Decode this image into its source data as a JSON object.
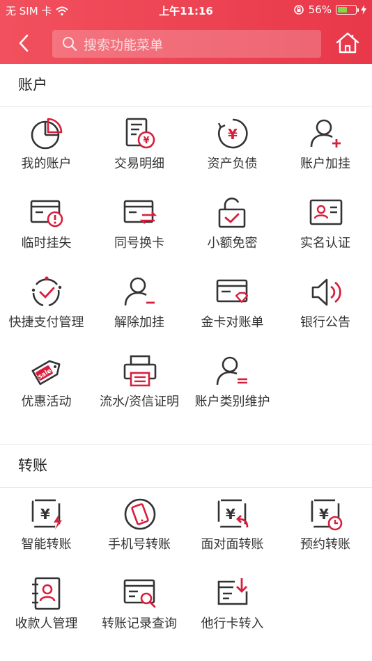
{
  "status_bar": {
    "carrier": "无 SIM 卡",
    "time": "上午11:16",
    "battery_pct": "56%",
    "battery_level": 0.56
  },
  "nav": {
    "search_placeholder": "搜索功能菜单"
  },
  "sections": {
    "account": {
      "title": "账户",
      "items": [
        {
          "label": "我的账户",
          "icon": "pie-chart-icon"
        },
        {
          "label": "交易明细",
          "icon": "transaction-detail-icon"
        },
        {
          "label": "资产负债",
          "icon": "asset-liability-icon"
        },
        {
          "label": "账户加挂",
          "icon": "add-user-icon"
        },
        {
          "label": "临时挂失",
          "icon": "card-report-loss-icon"
        },
        {
          "label": "同号换卡",
          "icon": "card-exchange-icon"
        },
        {
          "label": "小额免密",
          "icon": "unlock-icon"
        },
        {
          "label": "实名认证",
          "icon": "id-card-icon"
        },
        {
          "label": "快捷支付管理",
          "icon": "quick-pay-icon"
        },
        {
          "label": "解除加挂",
          "icon": "remove-user-icon"
        },
        {
          "label": "金卡对账单",
          "icon": "gold-card-statement-icon"
        },
        {
          "label": "银行公告",
          "icon": "speaker-icon"
        },
        {
          "label": "优惠活动",
          "icon": "sale-tag-icon"
        },
        {
          "label": "流水/资信证明",
          "icon": "printer-icon"
        },
        {
          "label": "账户类别维护",
          "icon": "user-category-icon"
        }
      ]
    },
    "transfer": {
      "title": "转账",
      "items": [
        {
          "label": "智能转账",
          "icon": "smart-transfer-icon"
        },
        {
          "label": "手机号转账",
          "icon": "phone-transfer-icon"
        },
        {
          "label": "面对面转账",
          "icon": "face-to-face-transfer-icon"
        },
        {
          "label": "预约转账",
          "icon": "scheduled-transfer-icon"
        },
        {
          "label": "收款人管理",
          "icon": "payee-book-icon"
        },
        {
          "label": "转账记录查询",
          "icon": "transfer-record-search-icon"
        },
        {
          "label": "他行卡转入",
          "icon": "other-bank-transfer-in-icon"
        }
      ]
    }
  },
  "colors": {
    "brand_red": "#e8384a",
    "icon_dark": "#333333",
    "icon_accent": "#d81e3c"
  }
}
